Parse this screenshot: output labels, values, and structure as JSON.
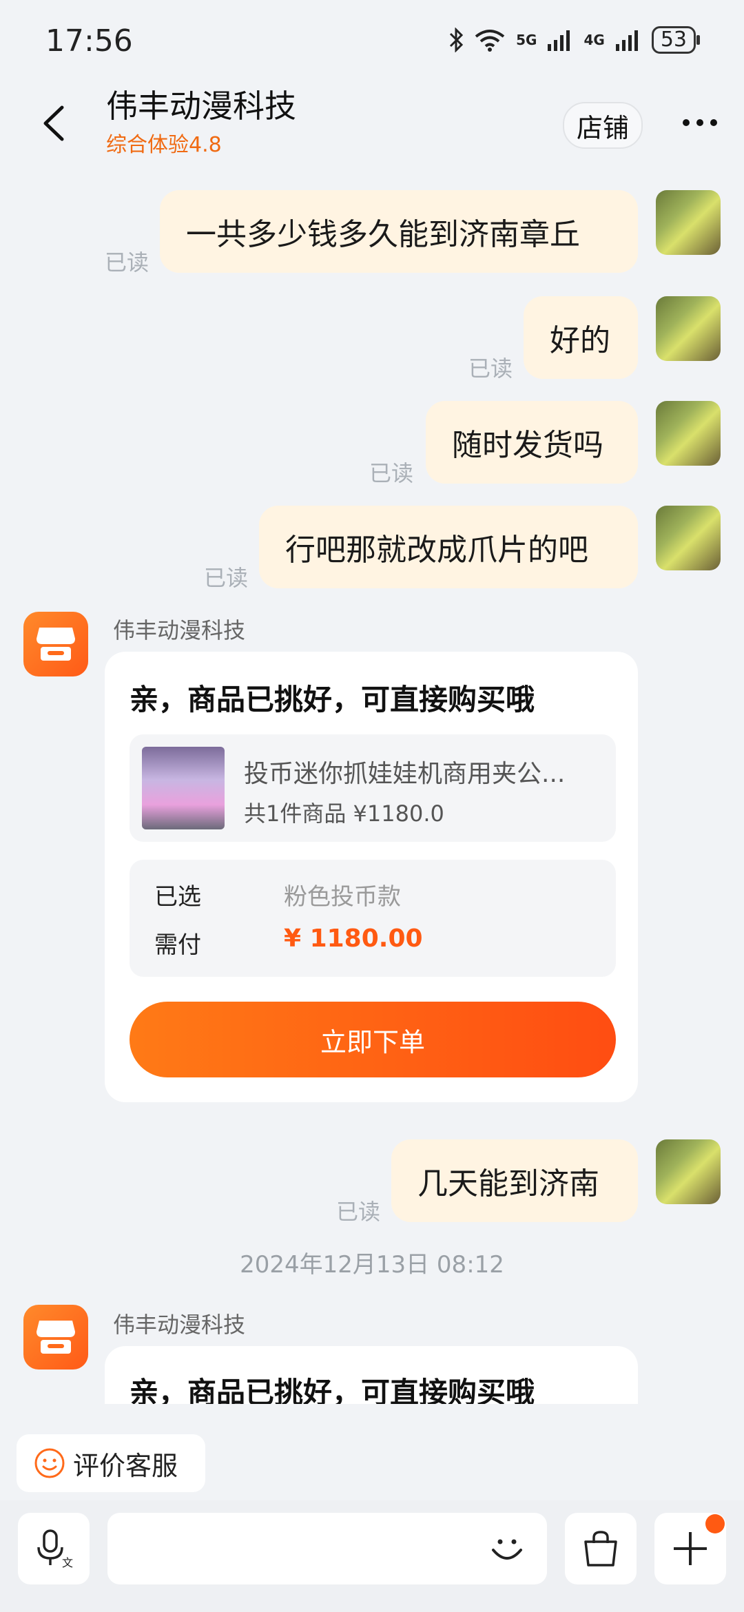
{
  "status_bar": {
    "time": "17:56",
    "network1": "5G",
    "network2": "4G",
    "battery": "53"
  },
  "header": {
    "shop_name": "伟丰动漫科技",
    "rating": "综合体验4.8",
    "store_button": "店铺"
  },
  "messages_out": [
    {
      "text": "一共多少钱多久能到济南章丘",
      "read": "已读"
    },
    {
      "text": "好的",
      "read": "已读"
    },
    {
      "text": "随时发货吗",
      "read": "已读"
    },
    {
      "text": "行吧那就改成爪片的吧",
      "read": "已读"
    },
    {
      "text": "几天能到济南",
      "read": "已读"
    }
  ],
  "shop_card": {
    "sender": "伟丰动漫科技",
    "title": "亲，商品已挑好，可直接购买哦",
    "product_title": "投币迷你抓娃娃机商用夹公...",
    "product_sub": "共1件商品 ¥1180.0",
    "selected_label": "已选",
    "selected_value": "粉色投币款",
    "pay_label": "需付",
    "pay_value": "¥ 1180.00",
    "order_button": "立即下单"
  },
  "timestamp": "2024年12月13日 08:12",
  "shop_card2": {
    "sender": "伟丰动漫科技",
    "title": "亲，商品已挑好，可直接购买哦"
  },
  "bottom": {
    "rate_service": "评价客服"
  },
  "colors": {
    "accent": "#ff5a12",
    "bubble_out": "#fff4e2",
    "background": "#f1f3f6"
  }
}
